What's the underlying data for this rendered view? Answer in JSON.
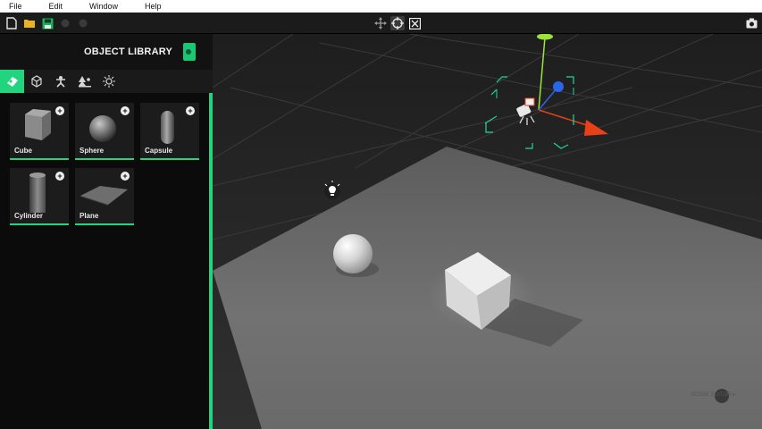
{
  "menu": {
    "items": [
      {
        "label": "File"
      },
      {
        "label": "Edit"
      },
      {
        "label": "Window"
      },
      {
        "label": "Help"
      }
    ]
  },
  "toolbar": {
    "left_icons": [
      "new-file-icon",
      "open-folder-icon",
      "save-icon",
      "undo-icon",
      "redo-icon"
    ],
    "center_icons": [
      "move-tool-icon",
      "rotate-tool-icon",
      "scale-tool-icon"
    ],
    "right_icons": [
      "camera-icon"
    ]
  },
  "panel": {
    "title": "OBJECT LIBRARY",
    "tabs": [
      "primitives-icon",
      "box-icon",
      "character-icon",
      "environment-icon",
      "light-icon"
    ],
    "objects": [
      {
        "label": "Cube",
        "add": "+"
      },
      {
        "label": "Sphere",
        "add": "+"
      },
      {
        "label": "Capsule",
        "add": "+"
      },
      {
        "label": "Cylinder",
        "add": "+"
      },
      {
        "label": "Plane",
        "add": "+"
      }
    ]
  },
  "colors": {
    "accent": "#22d47d",
    "gizmo_x": "#e8411a",
    "gizmo_y": "#9be23a",
    "gizmo_z": "#2a66e8",
    "selection": "#1fd6a0"
  },
  "viewport": {
    "watermark": "SCENE EDITOR ▸"
  }
}
